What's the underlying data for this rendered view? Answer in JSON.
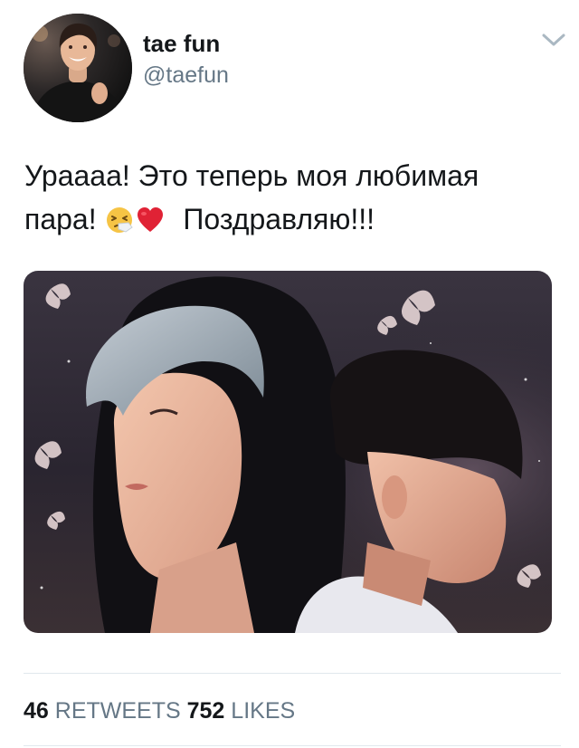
{
  "author": {
    "display_name": "tae fun",
    "handle": "@taefun",
    "avatar_icon": "profile-photo"
  },
  "menu": {
    "icon": "chevron-down-icon"
  },
  "tweet": {
    "line1": "Ураааа! Это теперь моя любимая",
    "line2_start": "пара!",
    "emojis": [
      "sneezing-face-emoji",
      "red-heart-emoji"
    ],
    "line2_end": "Поздравляю!!!"
  },
  "media": {
    "type": "illustration"
  },
  "stats": {
    "retweets_count": "46",
    "retweets_label": "RETWEETS",
    "likes_count": "752",
    "likes_label": "LIKES"
  },
  "colors": {
    "text": "#14171a",
    "secondary": "#657786",
    "divider": "#e1e8ed",
    "chevron": "#aab8c2"
  }
}
